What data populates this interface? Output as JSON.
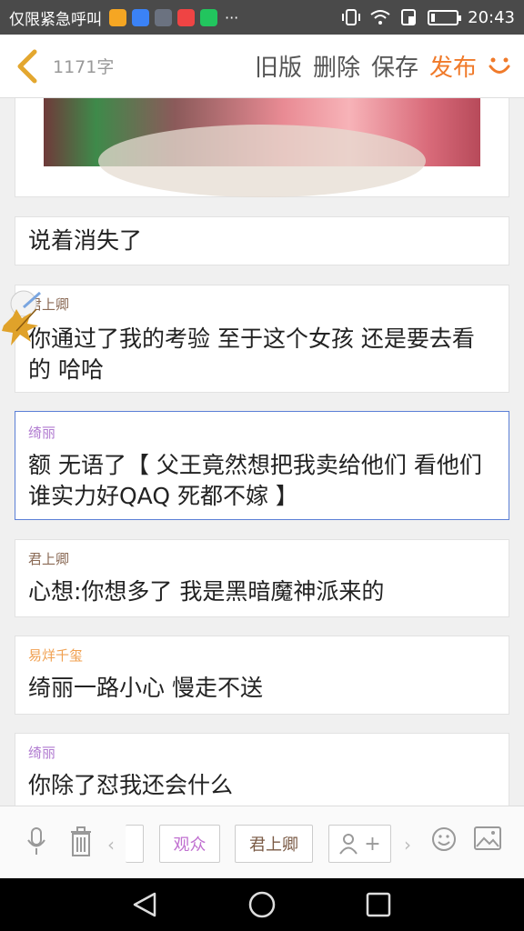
{
  "status_bar": {
    "carrier": "仅限紧急呼叫",
    "overflow": "···",
    "time": "20:43",
    "icons": [
      "vibrate-icon",
      "wifi-icon",
      "sim-icon",
      "battery-icon"
    ],
    "app_icon_colors": [
      "#f5a623",
      "#3b82f6",
      "#6b7280",
      "#ef4444",
      "#22c55e"
    ]
  },
  "header": {
    "word_count": "1171字",
    "old_version": "旧版",
    "delete": "删除",
    "save": "保存",
    "publish": "发布",
    "accent": "#f07a2a"
  },
  "cards": [
    {
      "text": "说着消失了"
    },
    {
      "speaker": "君上卿",
      "speaker_color": "#8a6a55",
      "text": "你通过了我的考验 至于这个女孩 还是要去看的 哈哈"
    },
    {
      "speaker": "绮丽",
      "speaker_color": "#b07ad0",
      "text": "额 无语了【 父王竟然想把我卖给他们 看他们谁实力好QAQ 死都不嫁 】",
      "selected": true
    },
    {
      "speaker": "君上卿",
      "speaker_color": "#8a6a55",
      "text": "心想:你想多了 我是黑暗魔神派来的"
    },
    {
      "speaker": "易烊千玺",
      "speaker_color": "#f0a050",
      "text": "绮丽一路小心 慢走不送"
    },
    {
      "speaker": "绮丽",
      "speaker_color": "#b07ad0",
      "text": "你除了怼我还会什么"
    }
  ],
  "toolbar": {
    "audience": "观众",
    "character": "君上卿",
    "add_plus": "+",
    "audience_color": "#c070d0",
    "character_color": "#7a5a45"
  }
}
